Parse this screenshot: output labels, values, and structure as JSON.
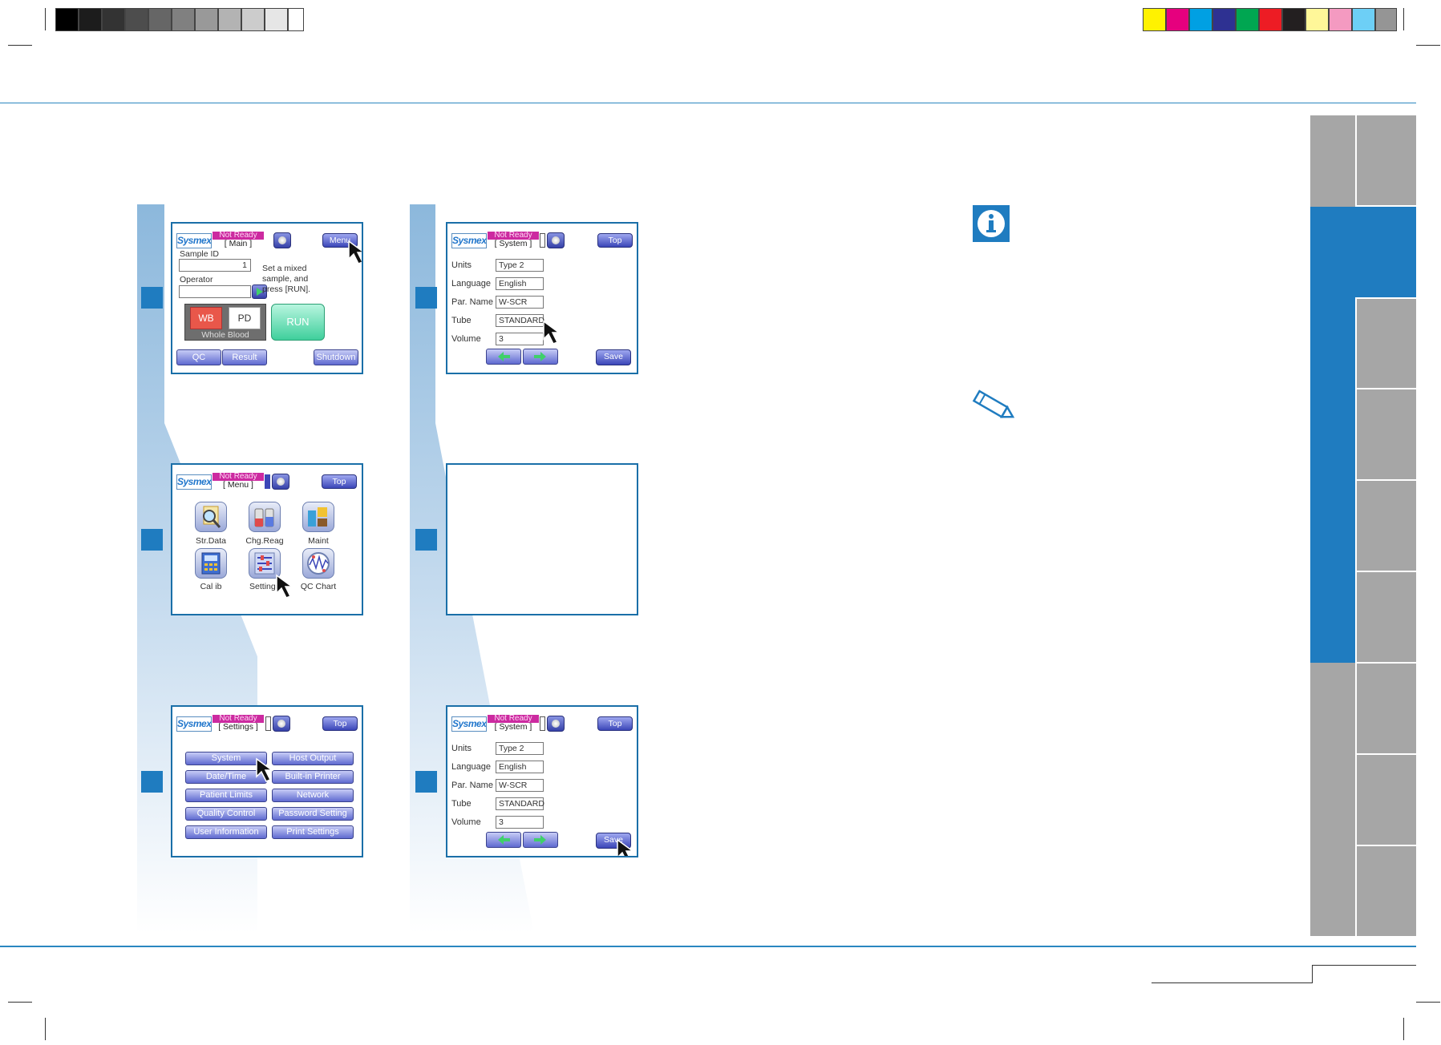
{
  "colors": {
    "accent": "#1f7cc0",
    "not_ready": "#cc2aa0",
    "button": "#5f6ad0",
    "run_button": "#3fcf9c",
    "wb_button": "#e9574a",
    "tab_gray": "#a6a6a6",
    "grays": [
      "#000000",
      "#1c1c1c",
      "#333333",
      "#4d4d4d",
      "#666666",
      "#808080",
      "#999999",
      "#b3b3b3",
      "#cccccc",
      "#e6e6e6",
      "#ffffff"
    ],
    "process": [
      "#fff200",
      "#e6007e",
      "#00a0e3",
      "#2e3192",
      "#00a651",
      "#ed1c24",
      "#231f20",
      "#fff799",
      "#f49ac1",
      "#6dcff6",
      "#959595"
    ]
  },
  "icons": {
    "info": "info-icon",
    "note": "pencil-icon",
    "pointer": "arrow-cursor-icon"
  },
  "screens": {
    "main": {
      "logo": "Sysmex",
      "status": "Not Ready",
      "title": "[ Main ]",
      "sample_id_label": "Sample ID",
      "sample_id_value": "1",
      "operator_label": "Operator",
      "operator_value": "",
      "instruction": "Set a mixed sample, and press [RUN].",
      "wb_label": "WB",
      "pd_label": "PD",
      "mode_label": "Whole Blood",
      "run_label": "RUN",
      "menu_label": "Menu",
      "qc_label": "QC",
      "result_label": "Result",
      "shutdown_label": "Shutdown"
    },
    "menu": {
      "logo": "Sysmex",
      "status": "Not Ready",
      "title": "[ Menu ]",
      "top_label": "Top",
      "items": [
        {
          "label": "Str.Data",
          "icon": "stored-data-icon"
        },
        {
          "label": "Chg.Reag",
          "icon": "change-reagent-icon"
        },
        {
          "label": "Maint",
          "icon": "maintenance-icon"
        },
        {
          "label": "Cal ib",
          "icon": "calibration-icon"
        },
        {
          "label": "Settings",
          "icon": "settings-icon"
        },
        {
          "label": "QC Chart",
          "icon": "qc-chart-icon"
        }
      ]
    },
    "settings": {
      "logo": "Sysmex",
      "status": "Not Ready",
      "title": "[ Settings ]",
      "top_label": "Top",
      "buttons": [
        "System",
        "Host Output",
        "Date/Time",
        "Built-in Printer",
        "Patient Limits",
        "Network",
        "Quality Control",
        "Password Setting",
        "User Information",
        "Print Settings"
      ]
    },
    "system": {
      "logo": "Sysmex",
      "status": "Not Ready",
      "title": "[ System ]",
      "top_label": "Top",
      "save_label": "Save",
      "fields": [
        {
          "label": "Units",
          "value": "Type 2"
        },
        {
          "label": "Language",
          "value": "English"
        },
        {
          "label": "Par. Name",
          "value": "W-SCR"
        },
        {
          "label": "Tube",
          "value": "STANDARD"
        },
        {
          "label": "Volume",
          "value": "3"
        }
      ]
    }
  }
}
